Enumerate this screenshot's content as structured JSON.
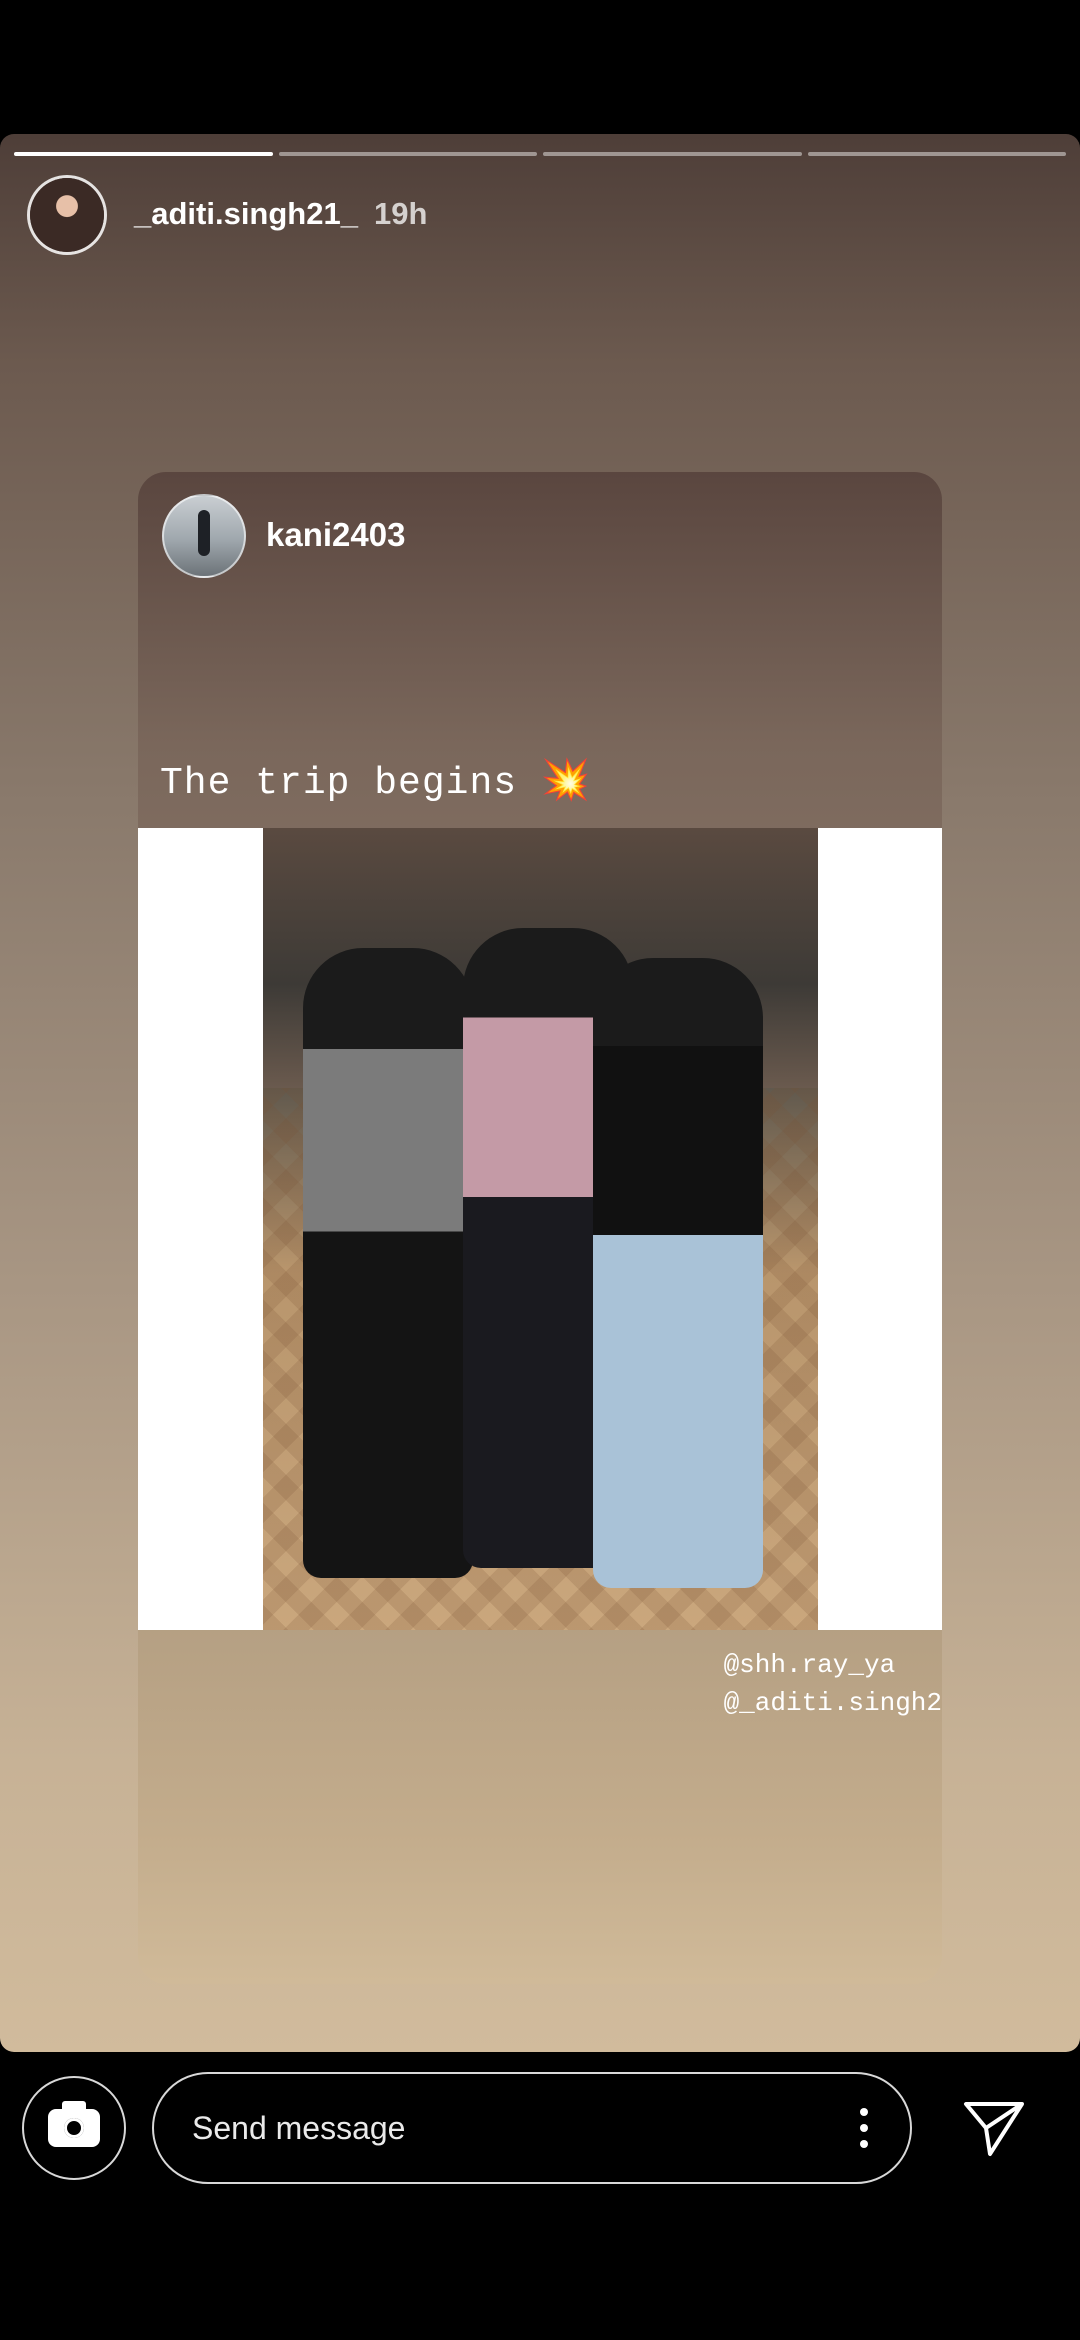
{
  "story": {
    "progress": {
      "total": 4,
      "current": 1
    },
    "header": {
      "username": "_aditi.singh21_",
      "time": "19h"
    },
    "shared_post": {
      "username": "kani2403",
      "caption": "The trip begins",
      "caption_emoji": "💥",
      "mentions": [
        "@shh.ray_ya",
        "@_aditi.singh2"
      ]
    }
  },
  "reply_bar": {
    "placeholder": "Send message"
  },
  "icons": {
    "camera": "camera-icon",
    "more": "more-vertical-icon",
    "send": "send-icon"
  }
}
